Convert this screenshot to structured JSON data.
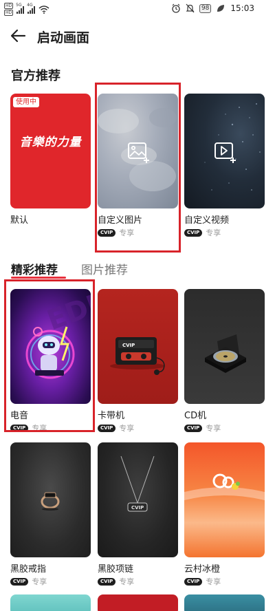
{
  "status_bar": {
    "sim1": "HD",
    "sim2": "HD",
    "net1": "5G",
    "net2": "4G",
    "battery": "98",
    "time": "15:03"
  },
  "header": {
    "title": "启动画面"
  },
  "official": {
    "title": "官方推荐",
    "cards": [
      {
        "name": "默认",
        "badge": "使用中",
        "cover_text": "音樂的力量"
      },
      {
        "name": "自定义图片",
        "vip": "CVIP",
        "vip_text": "专享"
      },
      {
        "name": "自定义视频",
        "vip": "CVIP",
        "vip_text": "专享"
      }
    ]
  },
  "tabs": [
    {
      "label": "精彩推荐",
      "active": true
    },
    {
      "label": "图片推荐",
      "active": false
    }
  ],
  "featured": [
    {
      "name": "电音",
      "vip": "CVIP",
      "vip_text": "专享"
    },
    {
      "name": "卡带机",
      "vip": "CVIP",
      "vip_text": "专享"
    },
    {
      "name": "CD机",
      "vip": "CVIP",
      "vip_text": "专享"
    },
    {
      "name": "黑胶戒指",
      "vip": "CVIP",
      "vip_text": "专享"
    },
    {
      "name": "黑胶项链",
      "vip": "CVIP",
      "vip_text": "专享"
    },
    {
      "name": "云村冰橙",
      "vip": "CVIP",
      "vip_text": "专享"
    }
  ],
  "icons": {
    "back": "arrow-left-icon",
    "add_image": "image-add-icon",
    "add_video": "video-add-icon"
  },
  "colors": {
    "accent_red": "#e8303d",
    "highlight_box": "#d8232a",
    "default_cover": "#e0262b",
    "orange_cover": "#f26b2a"
  }
}
